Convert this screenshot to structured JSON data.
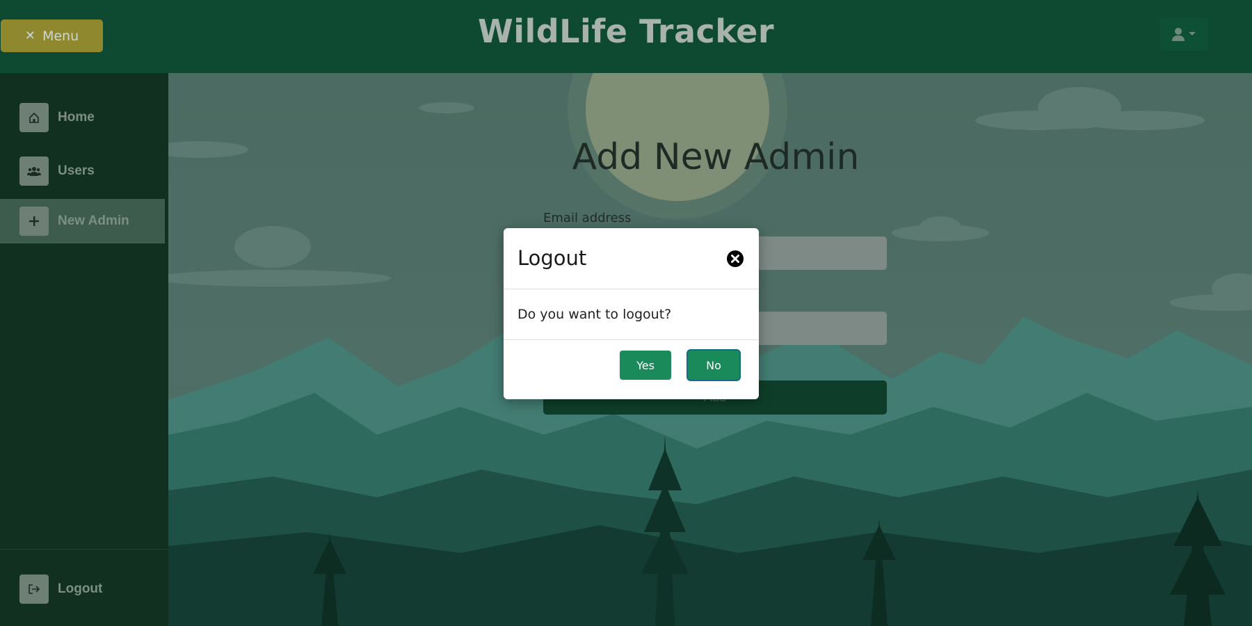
{
  "header": {
    "menu_label": "Menu",
    "menu_icon": "close-icon",
    "title": "WildLife Tracker",
    "user_icon": "user-icon"
  },
  "sidebar": {
    "items": [
      {
        "label": "Home",
        "icon": "home-icon",
        "active": false
      },
      {
        "label": "Users",
        "icon": "users-icon",
        "active": false
      },
      {
        "label": "New Admin",
        "icon": "plus-icon",
        "active": true
      }
    ],
    "logout": {
      "label": "Logout",
      "icon": "logout-icon"
    }
  },
  "main": {
    "title": "Add New Admin",
    "email_label": "Email address",
    "email_value": "",
    "second_field_value": "",
    "submit_label": "Add"
  },
  "modal": {
    "title": "Logout",
    "message": "Do you want to logout?",
    "yes_label": "Yes",
    "no_label": "No",
    "close_icon": "close-circle-icon"
  },
  "colors": {
    "header": "#0e4a32",
    "sidebar": "#12301f",
    "menu_button": "#b59a2e",
    "modal_button": "#1a8a5a"
  }
}
